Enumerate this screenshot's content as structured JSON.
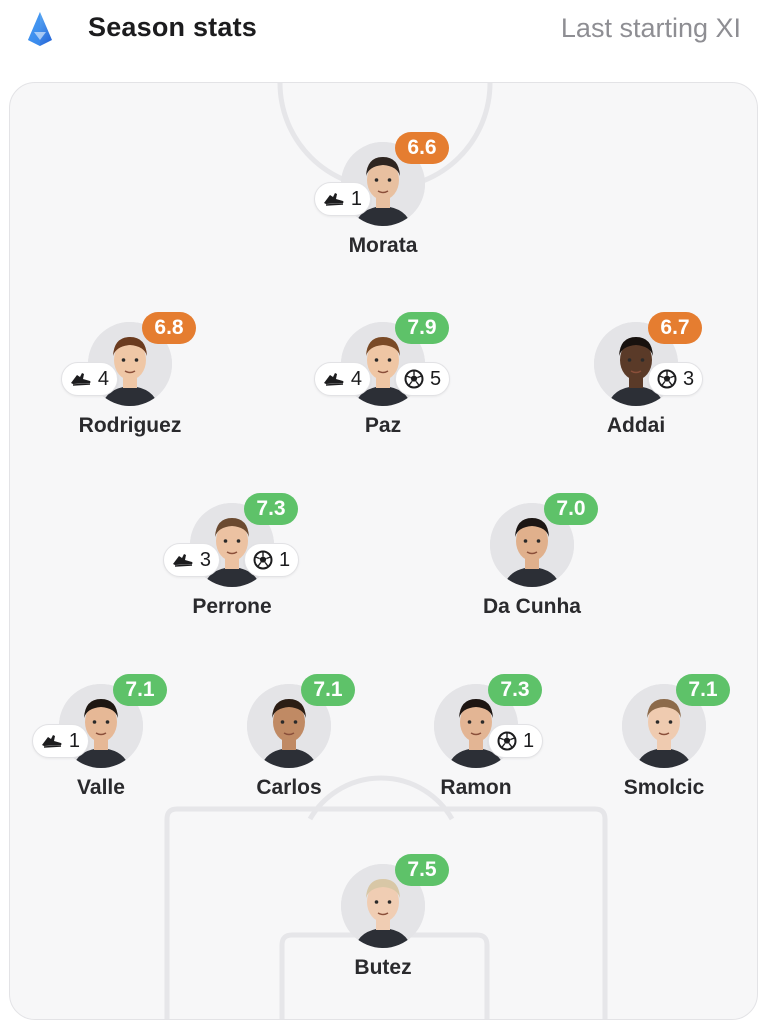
{
  "header": {
    "title": "Season stats",
    "subtitle": "Last starting XI",
    "league_icon": "league-logo-icon"
  },
  "colors": {
    "rating_green": "#5ec269",
    "rating_orange": "#e57d30",
    "pitch_bg": "#f7f7f8"
  },
  "players": [
    {
      "name": "Morata",
      "rating": "6.6",
      "rating_color": "orange",
      "assists": "1",
      "goals": null
    },
    {
      "name": "Rodriguez",
      "rating": "6.8",
      "rating_color": "orange",
      "assists": "4",
      "goals": null
    },
    {
      "name": "Paz",
      "rating": "7.9",
      "rating_color": "green",
      "assists": "4",
      "goals": "5"
    },
    {
      "name": "Addai",
      "rating": "6.7",
      "rating_color": "orange",
      "assists": null,
      "goals": "3"
    },
    {
      "name": "Perrone",
      "rating": "7.3",
      "rating_color": "green",
      "assists": "3",
      "goals": "1"
    },
    {
      "name": "Da Cunha",
      "rating": "7.0",
      "rating_color": "green",
      "assists": null,
      "goals": null
    },
    {
      "name": "Valle",
      "rating": "7.1",
      "rating_color": "green",
      "assists": "1",
      "goals": null
    },
    {
      "name": "Carlos",
      "rating": "7.1",
      "rating_color": "green",
      "assists": null,
      "goals": null
    },
    {
      "name": "Ramon",
      "rating": "7.3",
      "rating_color": "green",
      "assists": null,
      "goals": "1"
    },
    {
      "name": "Smolcic",
      "rating": "7.1",
      "rating_color": "green",
      "assists": null,
      "goals": null
    },
    {
      "name": "Butez",
      "rating": "7.5",
      "rating_color": "green",
      "assists": null,
      "goals": null
    }
  ],
  "icons": {
    "assist": "boot-icon",
    "goal": "football-icon"
  }
}
